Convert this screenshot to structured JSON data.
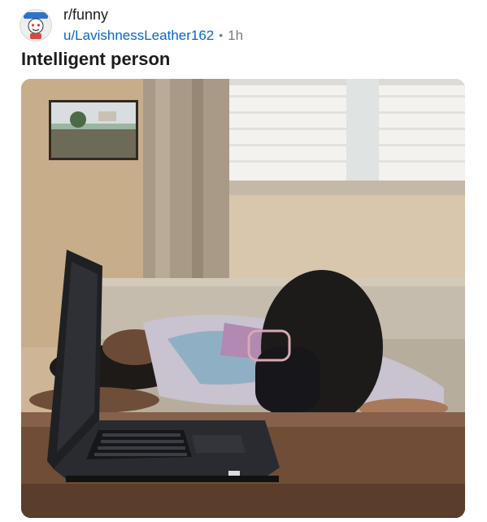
{
  "post": {
    "subreddit": "r/funny",
    "username": "u/LavishnessLeather162",
    "separator": "•",
    "age": "1h",
    "title": "Intelligent person"
  },
  "icons": {
    "avatar": "subreddit-mascot-icon"
  },
  "image": {
    "description_type": "photo"
  },
  "colors": {
    "username_link": "#0a66c8",
    "meta_gray": "#7c7c7c"
  }
}
